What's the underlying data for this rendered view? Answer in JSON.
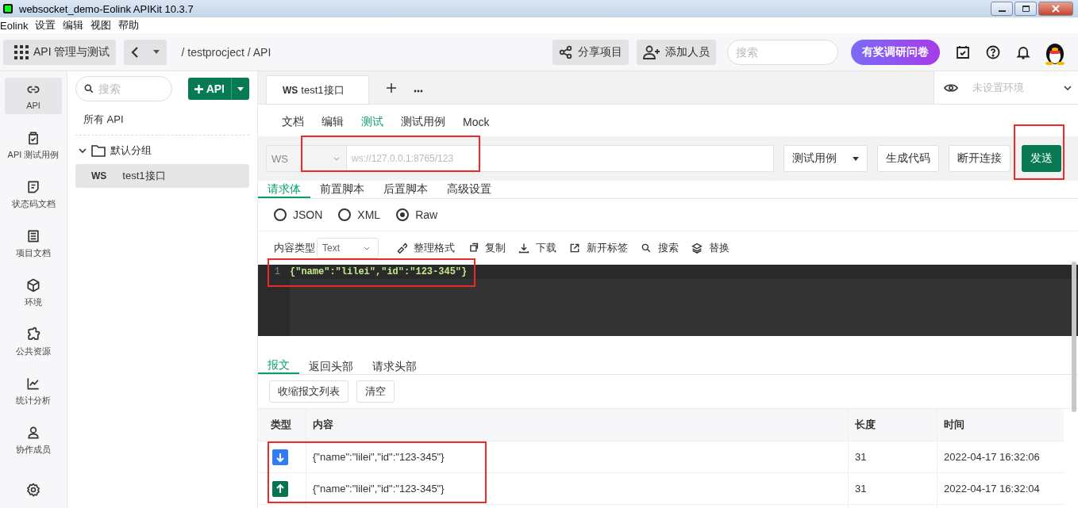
{
  "window": {
    "title": "websocket_demo-Eolink APIKit 10.3.7"
  },
  "menu": [
    "Eolink",
    "设置",
    "编辑",
    "视图",
    "帮助"
  ],
  "toolbar": {
    "app_switch": "API 管理与测试",
    "breadcrumb": "/ testprocject / API",
    "share": "分享项目",
    "add_member": "添加人员",
    "search": {
      "placeholder": "搜索"
    },
    "survey": "有奖调研问卷"
  },
  "nav": [
    {
      "label": "API",
      "selected": true
    },
    {
      "label": "API 测试用例",
      "selected": false
    },
    {
      "label": "状态码文档",
      "selected": false
    },
    {
      "label": "项目文档",
      "selected": false
    },
    {
      "label": "环境",
      "selected": false
    },
    {
      "label": "公共资源",
      "selected": false
    },
    {
      "label": "统计分析",
      "selected": false
    },
    {
      "label": "协作成员",
      "selected": false
    },
    {
      "selected": false
    }
  ],
  "api_panel": {
    "search": {
      "placeholder": "搜索"
    },
    "add_button": "API",
    "all": "所有 API",
    "groups": [
      {
        "name": "默认分组",
        "expanded": true,
        "children": [
          {
            "method": "WS",
            "name": "test1接口",
            "selected": true
          }
        ]
      }
    ]
  },
  "tabs": [
    {
      "method": "WS",
      "name": "test1接口",
      "selected": true
    }
  ],
  "environment": {
    "placeholder": "未设置环境"
  },
  "sub_tabs": [
    {
      "label": "文档",
      "selected": false
    },
    {
      "label": "编辑",
      "selected": false
    },
    {
      "label": "测试",
      "selected": true
    },
    {
      "label": "测试用例",
      "selected": false
    },
    {
      "label": "Mock",
      "selected": false
    }
  ],
  "request": {
    "protocol": "WS",
    "url": {
      "placeholder": "ws://127.0.0.1:8765/123"
    },
    "url_highlighted": true,
    "test_case": "测试用例",
    "gen_code": "生成代码",
    "disconnect": "断开连接",
    "send": "发送",
    "send_highlighted": true
  },
  "body_tabs": [
    {
      "label": "请求体",
      "selected": true
    },
    {
      "label": "前置脚本",
      "selected": false
    },
    {
      "label": "后置脚本",
      "selected": false
    },
    {
      "label": "高级设置",
      "selected": false
    }
  ],
  "formats": [
    {
      "label": "JSON",
      "selected": false
    },
    {
      "label": "XML",
      "selected": false
    },
    {
      "label": "Raw",
      "selected": true
    }
  ],
  "editor_toolbar": {
    "content_type_label": "内容类型",
    "content_type": "Text",
    "actions": [
      "整理格式",
      "复制",
      "下载",
      "新开标签",
      "搜索",
      "替换"
    ]
  },
  "editor": {
    "highlighted": true,
    "lines": [
      {
        "number": "1",
        "code": "{\"name\":\"lilei\",\"id\":\"123-345\"}"
      }
    ]
  },
  "result_tabs": [
    {
      "label": "报文",
      "selected": true
    },
    {
      "label": "返回头部",
      "selected": false
    },
    {
      "label": "请求头部",
      "selected": false
    }
  ],
  "result_buttons": [
    "收缩报文列表",
    "清空"
  ],
  "messages": {
    "columns": [
      "类型",
      "内容",
      "长度",
      "时间"
    ],
    "highlighted": true,
    "rows": [
      {
        "kind": "received",
        "content": "{\"name\":\"lilei\",\"id\":\"123-345\"}",
        "length": "31",
        "time": "2022-04-17 16:32:06"
      },
      {
        "kind": "sent",
        "content": "{\"name\":\"lilei\",\"id\":\"123-345\"}",
        "length": "31",
        "time": "2022-04-17 16:32:04"
      }
    ]
  }
}
